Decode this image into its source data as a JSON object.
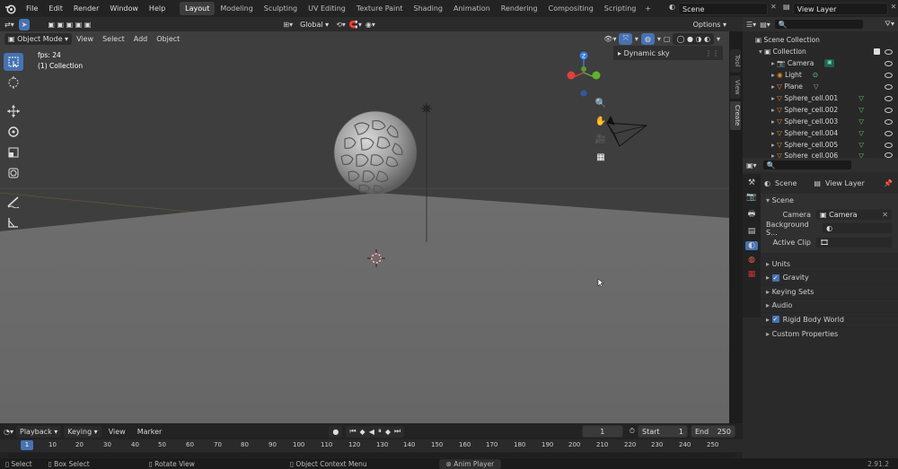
{
  "menubar": {
    "items": [
      "File",
      "Edit",
      "Render",
      "Window",
      "Help"
    ]
  },
  "workspace_tabs": [
    "Layout",
    "Modeling",
    "Sculpting",
    "UV Editing",
    "Texture Paint",
    "Shading",
    "Animation",
    "Rendering",
    "Compositing",
    "Scripting"
  ],
  "active_tab": "Layout",
  "scene_field": "Scene",
  "view_layer_field": "View Layer",
  "viewport_toolbar": {
    "transform_orientation": "Global",
    "options": "Options"
  },
  "viewport_header": {
    "mode": "Object Mode",
    "menus": [
      "View",
      "Select",
      "Add",
      "Object"
    ]
  },
  "viewport_overlay": {
    "fps": "fps: 24",
    "collection": "(1) Collection",
    "hdri_panel": "Dynamic sky"
  },
  "side_tabs": [
    "Tool",
    "View",
    "Create"
  ],
  "outliner": {
    "root": "Scene Collection",
    "collection": "Collection",
    "items": [
      "Camera",
      "Light",
      "Plane",
      "Sphere_cell.001",
      "Sphere_cell.002",
      "Sphere_cell.003",
      "Sphere_cell.004",
      "Sphere_cell.005",
      "Sphere_cell.006"
    ]
  },
  "properties": {
    "breadcrumb_scene": "Scene",
    "breadcrumb_layer": "View Layer",
    "panel": "Scene",
    "camera_label": "Camera",
    "camera_value": "Camera",
    "background_label": "Background S...",
    "clip_label": "Active Clip",
    "sections": [
      {
        "label": "Units",
        "checkbox": false
      },
      {
        "label": "Gravity",
        "checkbox": true
      },
      {
        "label": "Keying Sets",
        "checkbox": false
      },
      {
        "label": "Audio",
        "checkbox": false
      },
      {
        "label": "Rigid Body World",
        "checkbox": true
      },
      {
        "label": "Custom Properties",
        "checkbox": false
      }
    ]
  },
  "timeline": {
    "menus": [
      "Playback",
      "Keying",
      "View",
      "Marker"
    ],
    "current_frame": "1",
    "start_label": "Start",
    "start": "1",
    "end_label": "End",
    "end": "250",
    "ticks": [
      "1",
      "10",
      "20",
      "30",
      "40",
      "50",
      "60",
      "70",
      "80",
      "90",
      "100",
      "110",
      "120",
      "130",
      "140",
      "150",
      "160",
      "170",
      "180",
      "190",
      "200",
      "210",
      "220",
      "230",
      "240",
      "250"
    ]
  },
  "statusbar": {
    "select": "Select",
    "box_select": "Box Select",
    "rotate": "Rotate View",
    "context": "Object Context Menu",
    "anim_player": "Anim Player",
    "version": "2.91.2"
  },
  "colors": {
    "accent": "#4772b3",
    "viewport": "#3e3e3e",
    "ground": "#6a6a6a",
    "orange": "#e8882a",
    "green": "#60c46a"
  }
}
